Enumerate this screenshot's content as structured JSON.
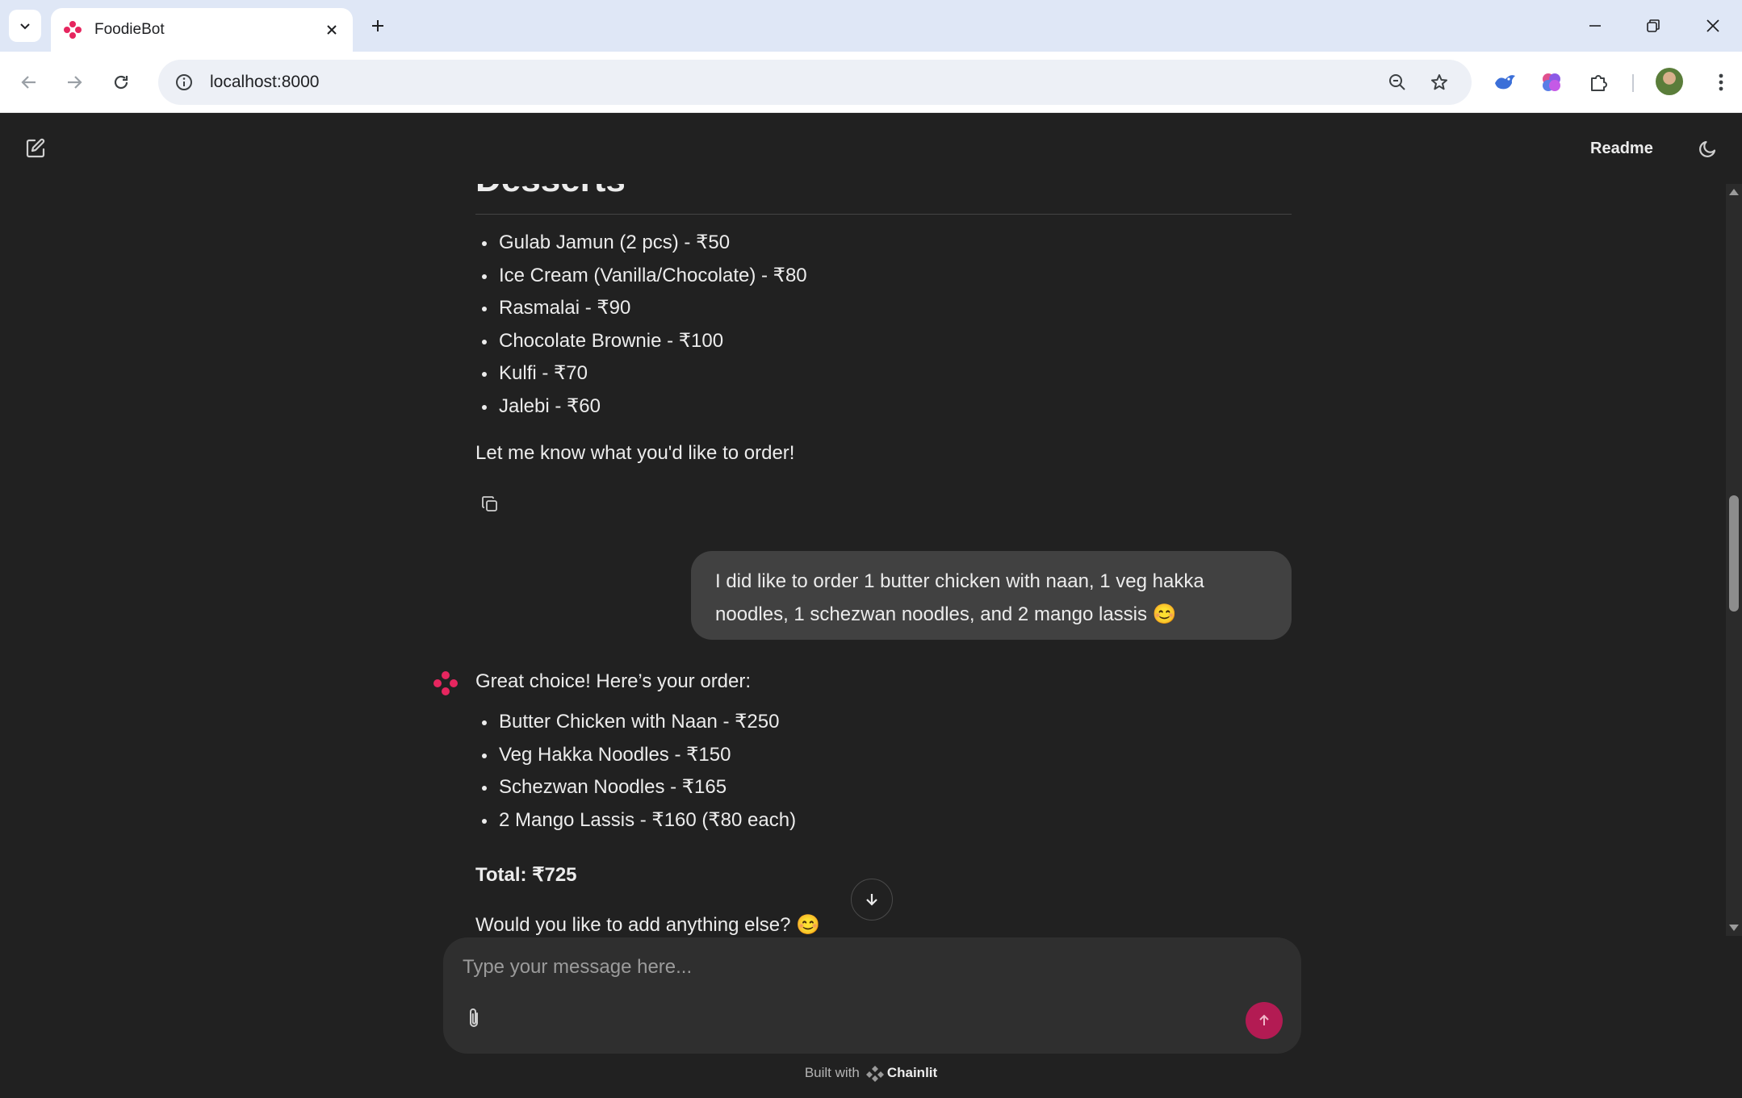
{
  "browser": {
    "tab_title": "FoodieBot",
    "url": "localhost:8000"
  },
  "app": {
    "readme_label": "Readme",
    "accent_color": "#b31b53"
  },
  "chat": {
    "section_heading": "Desserts",
    "desserts": [
      "Gulab Jamun (2 pcs) - ₹50",
      "Ice Cream (Vanilla/Chocolate) - ₹80",
      "Rasmalai - ₹90",
      "Chocolate Brownie - ₹100",
      "Kulfi - ₹70",
      "Jalebi - ₹60"
    ],
    "menu_closing": "Let me know what you'd like to order!",
    "user_message": "I did like to order 1 butter chicken with naan, 1 veg hakka noodles, 1 schezwan noodles, and 2 mango lassis 😊",
    "bot_intro": "Great choice! Here’s your order:",
    "order_items": [
      "Butter Chicken with Naan - ₹250",
      "Veg Hakka Noodles - ₹150",
      "Schezwan Noodles - ₹165",
      "2 Mango Lassis - ₹160 (₹80 each)"
    ],
    "total": "Total: ₹725",
    "follow_up": "Would you like to add anything else? 😊"
  },
  "composer": {
    "placeholder": "Type your message here..."
  },
  "footer": {
    "built_with": "Built with",
    "brand": "Chainlit"
  }
}
